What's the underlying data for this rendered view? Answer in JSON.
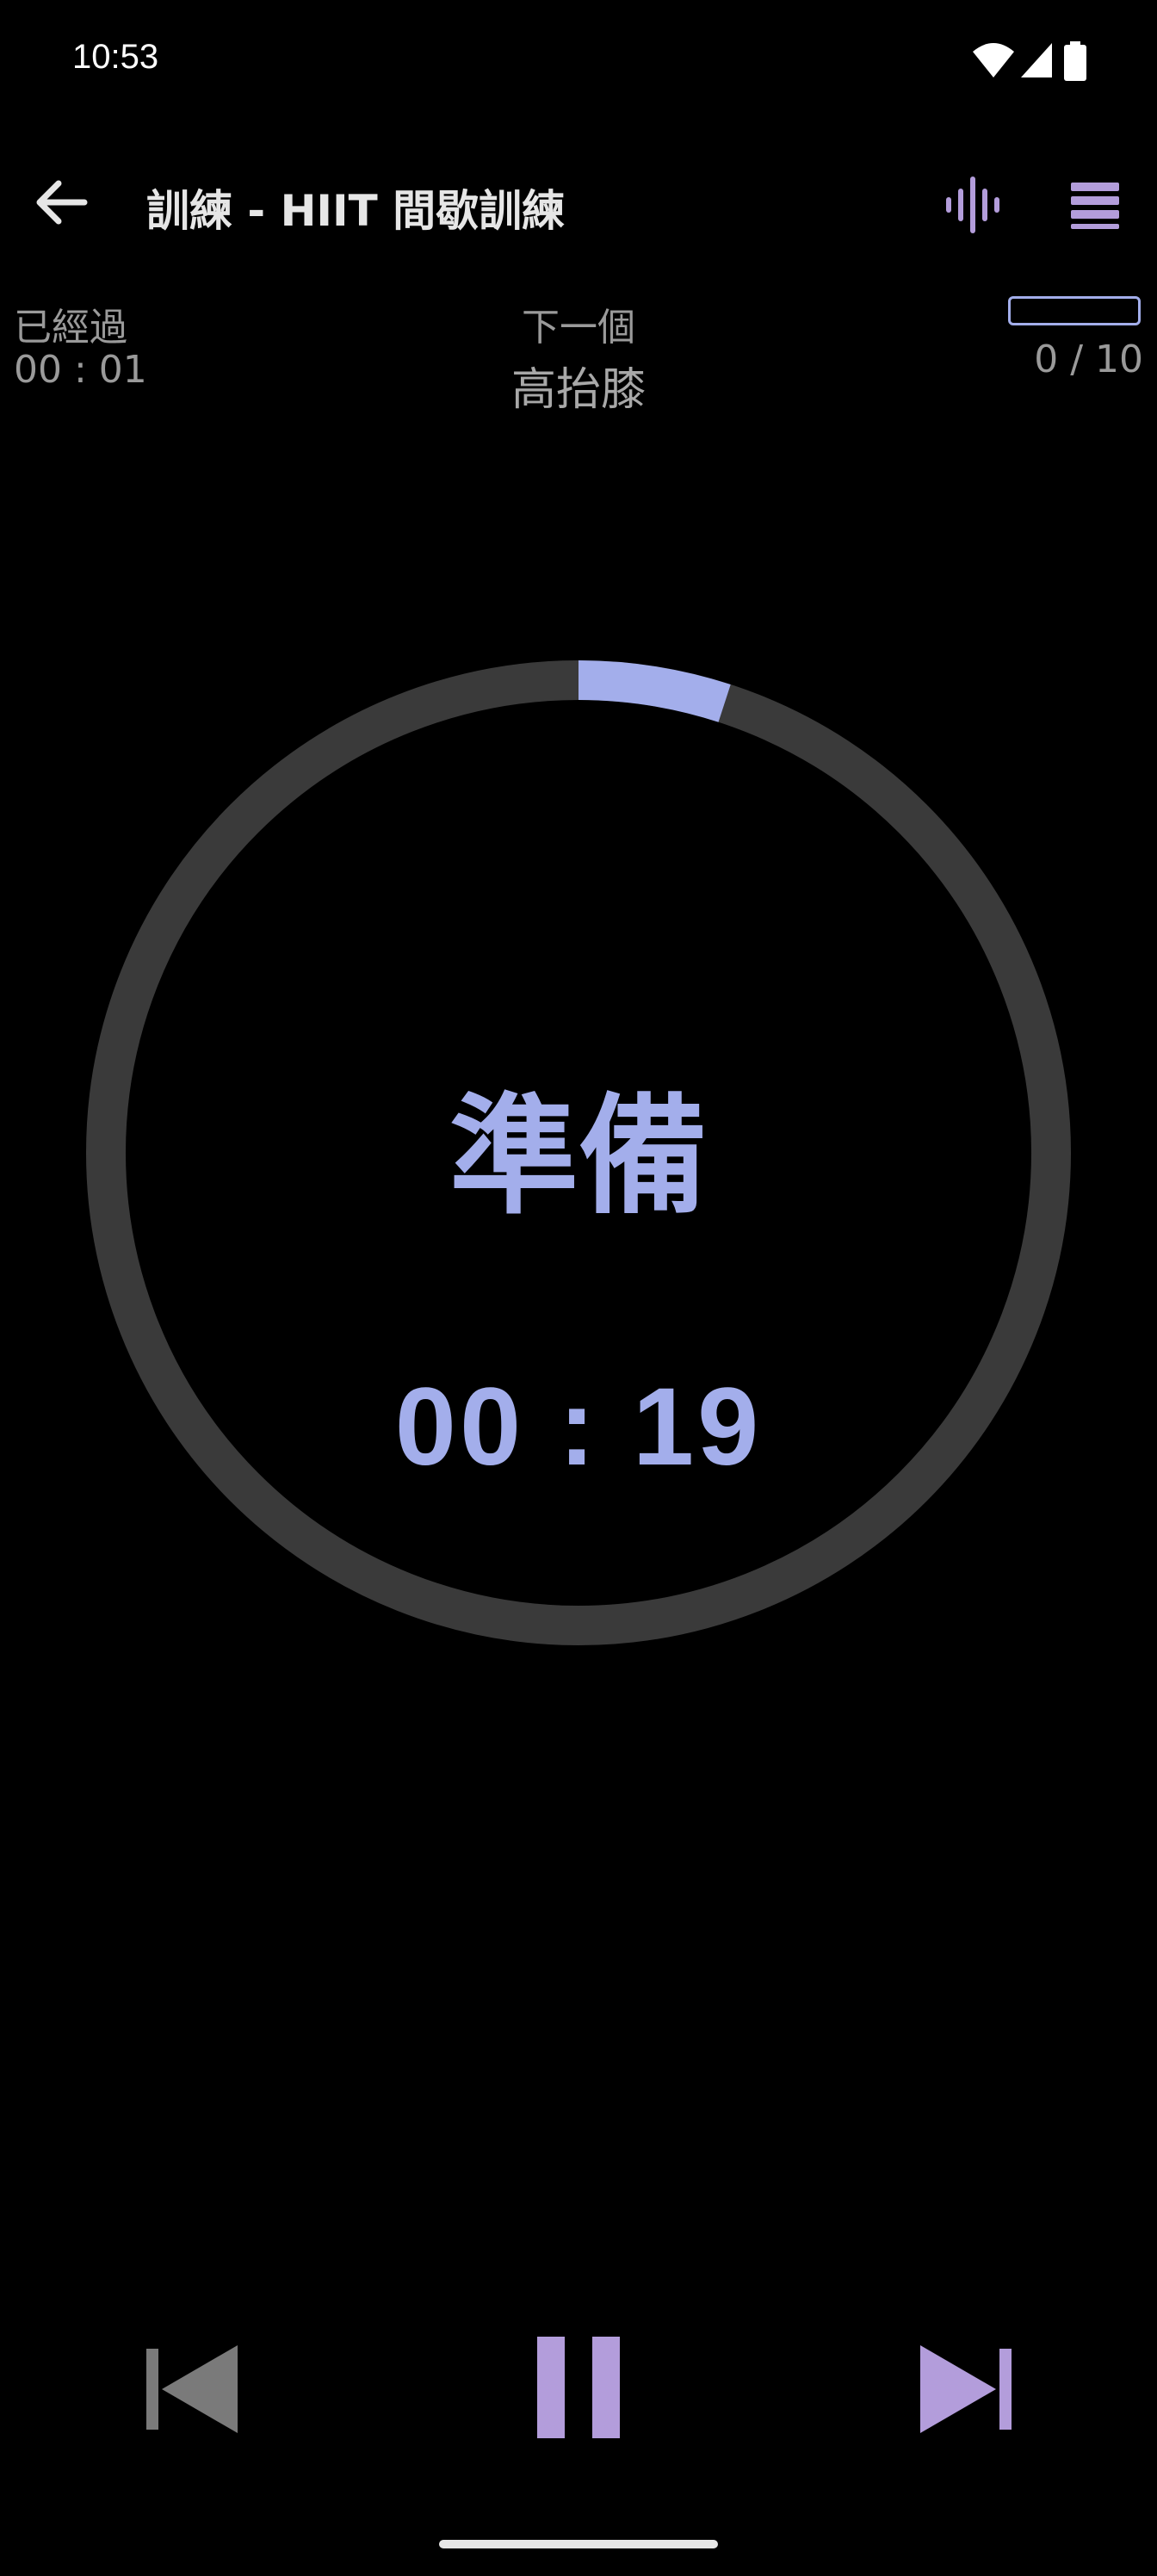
{
  "status_bar": {
    "time": "10:53",
    "icons": [
      "wifi-icon",
      "cellular-signal-icon",
      "battery-icon"
    ]
  },
  "toolbar": {
    "back_icon": "arrow-back-icon",
    "title": "訓練 - HIIT 間歇訓練",
    "sound_icon": "sound-wave-icon",
    "menu_icon": "menu-icon"
  },
  "info": {
    "elapsed_label": "已經過",
    "elapsed_value": "00 : 01",
    "next_label": "下一個",
    "next_value": "高抬膝",
    "progress_count": "0 / 10",
    "progress_fraction": 0
  },
  "timer": {
    "phase": "準備",
    "countdown": "00 : 19",
    "ring_progress_fraction": 0.05
  },
  "controls": {
    "previous_icon": "skip-previous-icon",
    "pause_icon": "pause-icon",
    "next_icon": "skip-next-icon"
  },
  "colors": {
    "accent": "#a3aeeb",
    "accent_purple": "#b39ddb",
    "ring_track": "#3a3a3a",
    "background": "#000000",
    "disabled": "#7a7a7a"
  }
}
